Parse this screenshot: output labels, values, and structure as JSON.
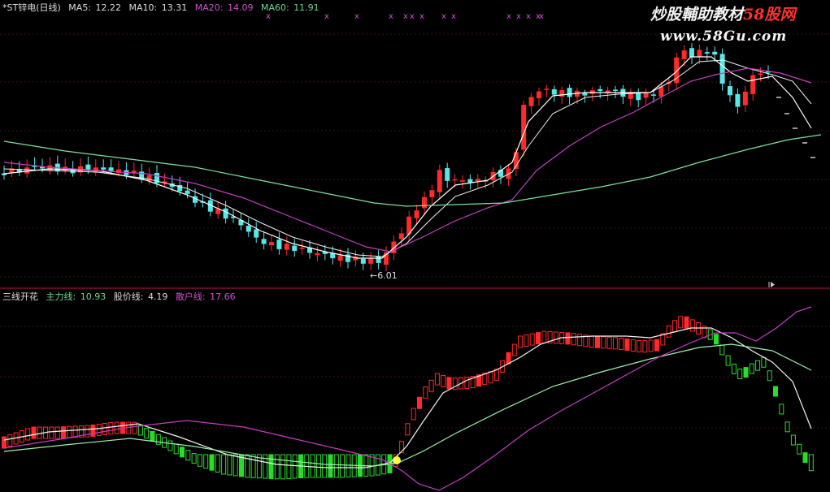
{
  "top_panel": {
    "legend": {
      "name": "*ST锌电(日线)",
      "ma5_label": "MA5:",
      "ma5_value": "12.22",
      "ma10_label": "MA10:",
      "ma10_value": "13.31",
      "ma20_label": "MA20:",
      "ma20_value": "14.09",
      "ma60_label": "MA60:",
      "ma60_value": "11.91"
    },
    "low_annotation": "←6.01",
    "signal_marker": "x"
  },
  "bottom_panel": {
    "legend": {
      "name": "三线开花",
      "line1_label": "主力线:",
      "line1_value": "10.93",
      "line2_label": "股价线:",
      "line2_value": "4.19",
      "line3_label": "散户线:",
      "line3_value": "17.66"
    }
  },
  "watermark": {
    "line1_a": "炒股輔助教材",
    "line1_b": "58股网",
    "line2": "www.58Gu.com"
  },
  "colors": {
    "background": "#000000",
    "up": "#ff2a2a",
    "down": "#55e8e8",
    "ma5": "#ffffff",
    "ma20": "#c040c0",
    "ma60": "#80e0a0",
    "bottom_green": "#2adc2a",
    "marker": "#ffff40",
    "divider": "#7a1030",
    "grid": "#3a1220"
  },
  "icons": {
    "scroll_marker": "right-arrow-icon"
  }
}
